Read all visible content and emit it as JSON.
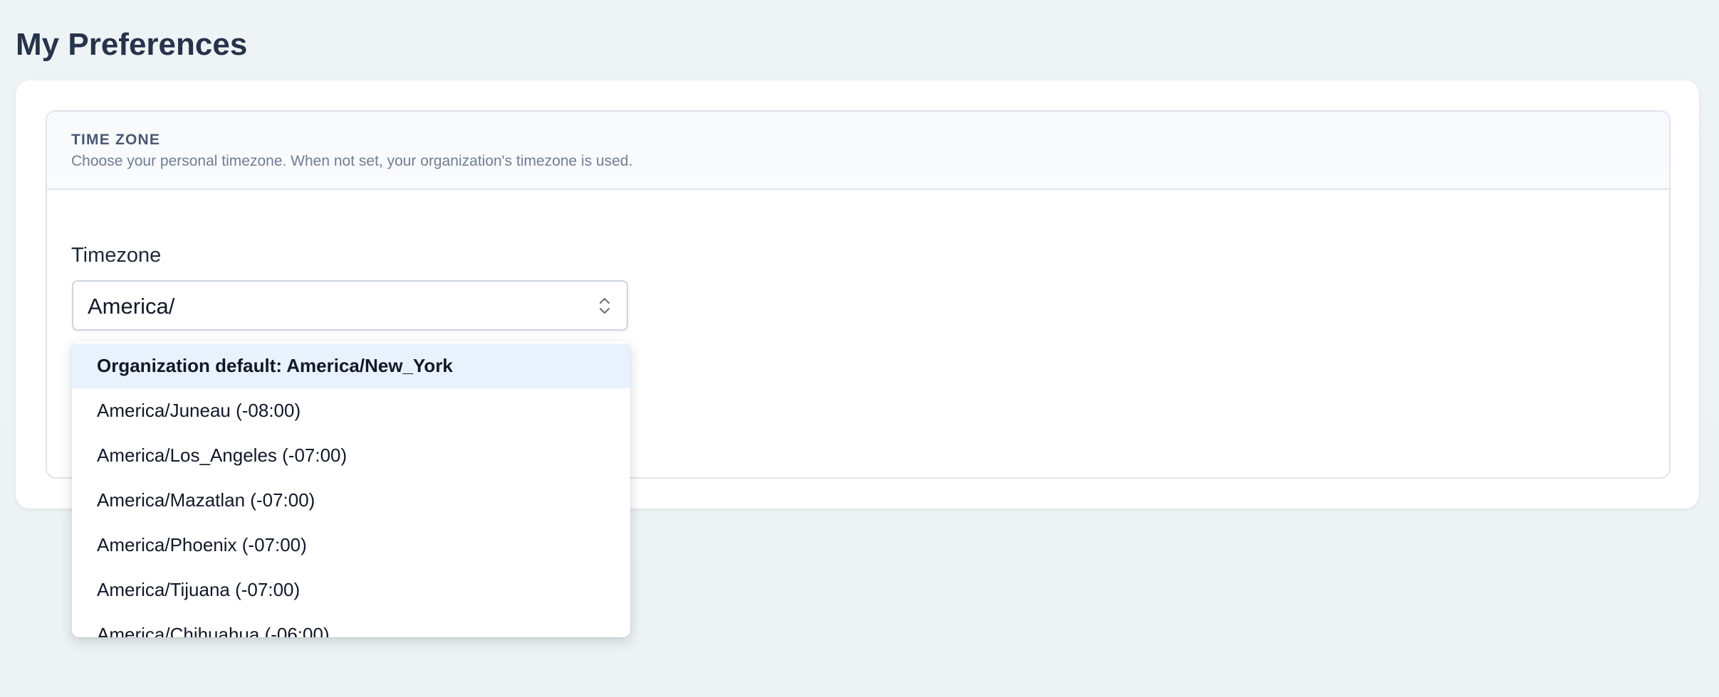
{
  "page": {
    "title": "My Preferences"
  },
  "time_zone_section": {
    "title": "TIME ZONE",
    "description": "Choose your personal timezone. When not set, your organization's timezone is used."
  },
  "timezone_field": {
    "label": "Timezone",
    "value": "America/",
    "icon": "chevron-up-down-icon"
  },
  "dropdown": {
    "options": [
      {
        "label": "Organization default: America/New_York",
        "highlighted": true
      },
      {
        "label": "America/Juneau (-08:00)",
        "highlighted": false
      },
      {
        "label": "America/Los_Angeles (-07:00)",
        "highlighted": false
      },
      {
        "label": "America/Mazatlan (-07:00)",
        "highlighted": false
      },
      {
        "label": "America/Phoenix (-07:00)",
        "highlighted": false
      },
      {
        "label": "America/Tijuana (-07:00)",
        "highlighted": false
      },
      {
        "label": "America/Chihuahua (-06:00)",
        "highlighted": false
      }
    ]
  },
  "colors": {
    "highlight": "#e8f2fc",
    "title": "#27334a",
    "section_title": "#4a5873",
    "muted_text": "#6f7e94"
  }
}
